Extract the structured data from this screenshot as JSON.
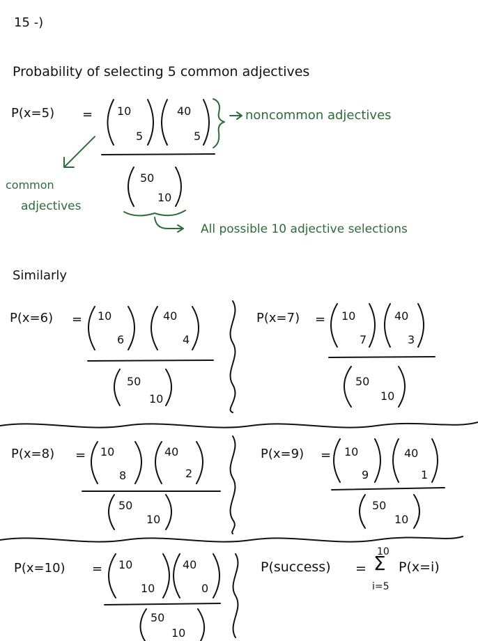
{
  "problem": {
    "number": "15 -)"
  },
  "heading": "Probability of selecting 5 common adjectives",
  "eq5": {
    "lhs": "P(x=5)",
    "eq": "=",
    "c1_top": "10",
    "c1_bot": "5",
    "c2_top": "40",
    "c2_bot": "5",
    "d_top": "50",
    "d_bot": "10"
  },
  "annotations": {
    "noncommon": "noncommon adjectives",
    "common_line1": "common",
    "common_line2": "adjectives",
    "all_possible": "All possible 10 adjective selections"
  },
  "similarly": "Similarly",
  "eq6": {
    "lhs": "P(x=6)",
    "eq": "=",
    "c1_top": "10",
    "c1_bot": "6",
    "c2_top": "40",
    "c2_bot": "4",
    "d_top": "50",
    "d_bot": "10"
  },
  "eq7": {
    "lhs": "P(x=7)",
    "eq": "=",
    "c1_top": "10",
    "c1_bot": "7",
    "c2_top": "40",
    "c2_bot": "3",
    "d_top": "50",
    "d_bot": "10"
  },
  "eq8": {
    "lhs": "P(x=8)",
    "eq": "=",
    "c1_top": "10",
    "c1_bot": "8",
    "c2_top": "40",
    "c2_bot": "2",
    "d_top": "50",
    "d_bot": "10"
  },
  "eq9": {
    "lhs": "P(x=9)",
    "eq": "=",
    "c1_top": "10",
    "c1_bot": "9",
    "c2_top": "40",
    "c2_bot": "1",
    "d_top": "50",
    "d_bot": "10"
  },
  "eq10": {
    "lhs": "P(x=10)",
    "eq": "=",
    "c1_top": "10",
    "c1_bot": "10",
    "c2_top": "40",
    "c2_bot": "0",
    "d_top": "50",
    "d_bot": "10"
  },
  "success": {
    "lhs": "P(success)",
    "eq": "=",
    "sigma": "Σ",
    "upper": "10",
    "lower": "i=5",
    "term": "P(x=i)"
  },
  "colors": {
    "ink": "#111111",
    "annotation": "#2e6b3a"
  }
}
